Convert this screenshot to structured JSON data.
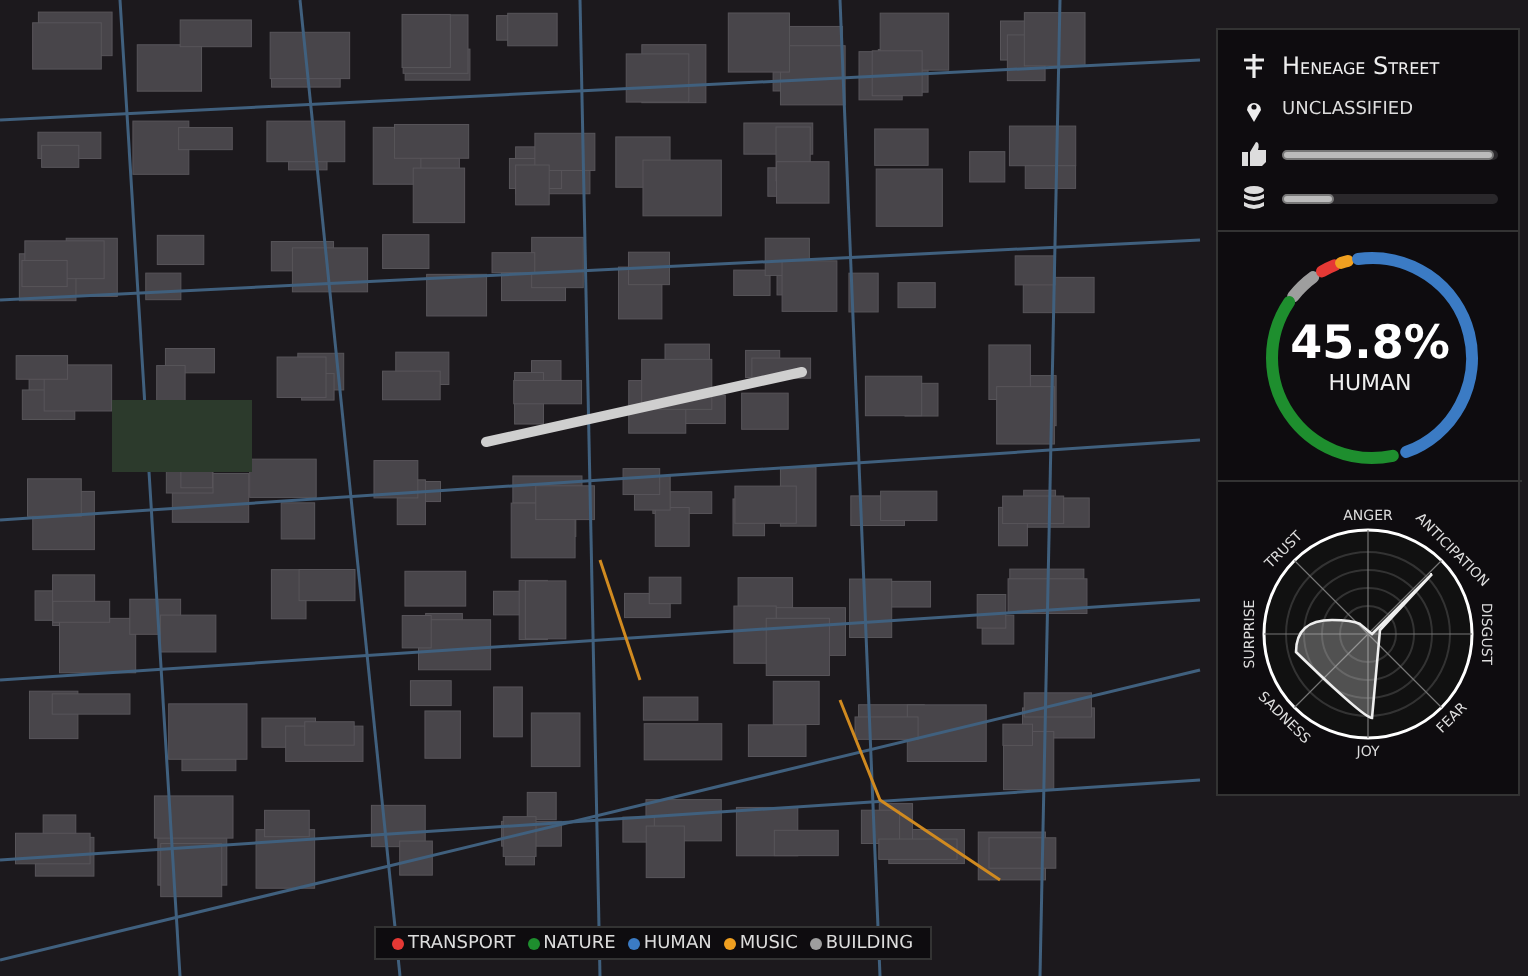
{
  "street": {
    "name": "Heneage Street",
    "classification": "UNCLASSIFIED",
    "likes": {
      "level": 0.98
    },
    "data": {
      "level": 0.24
    }
  },
  "share": {
    "value": "45.8%",
    "label": "HUMAN"
  },
  "emotions": {
    "axes": [
      "ANGER",
      "ANTICIPATION",
      "DISGUST",
      "FEAR",
      "JOY",
      "SADNESS",
      "SURPRISE",
      "TRUST"
    ]
  },
  "legend": [
    {
      "label": "TRANSPORT",
      "color": "#e53935"
    },
    {
      "label": "NATURE",
      "color": "#1e8e2e"
    },
    {
      "label": "HUMAN",
      "color": "#3b7bc4"
    },
    {
      "label": "MUSIC",
      "color": "#f0a020"
    },
    {
      "label": "BUILDING",
      "color": "#9e9e9e"
    }
  ]
}
